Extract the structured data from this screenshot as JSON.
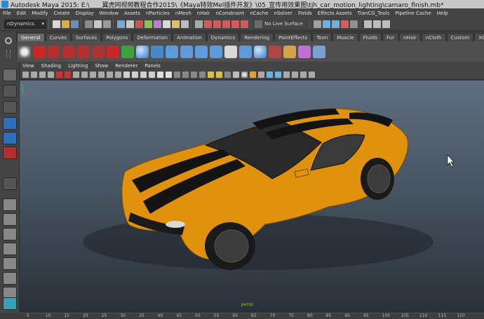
{
  "window": {
    "title": "Autodesk Maya 2015: E:\\____翼虎网视频教程合作2015\\《Maya特效Mel插件开发》\\05_宣传用效果图\\tjh_car_motion_lighting\\camaro_finish.mb*"
  },
  "menubar": {
    "items": [
      "File",
      "Edit",
      "Modify",
      "Create",
      "Display",
      "Window",
      "Assets",
      "nParticles",
      "nMesh",
      "nHair",
      "nConstraint",
      "nCache",
      "nSolver",
      "Fields",
      "Effects Assets",
      "TianCG_Tools",
      "Pipeline Cache",
      "Help"
    ]
  },
  "statusline": {
    "mode_value": "nDynamics",
    "live_surface_label": "No Live Surface"
  },
  "shelf": {
    "tabs": [
      "General",
      "Curves",
      "Surfaces",
      "Polygons",
      "Deformation",
      "Animation",
      "Dynamics",
      "Rendering",
      "PaintEffects",
      "Toon",
      "Muscle",
      "Fluids",
      "Fur",
      "nHair",
      "nCloth",
      "Custom",
      "XGen"
    ],
    "active_tab": "General"
  },
  "panel_menu": {
    "items": [
      "View",
      "Shading",
      "Lighting",
      "Show",
      "Renderer",
      "Panels"
    ]
  },
  "viewport": {
    "camera_label": "persp"
  },
  "timeslider": {
    "ticks": [
      "5",
      "10",
      "15",
      "20",
      "25",
      "30",
      "35",
      "40",
      "45",
      "50",
      "55",
      "60",
      "65",
      "70",
      "75",
      "80",
      "85",
      "90",
      "95",
      "100",
      "105",
      "110",
      "115",
      "120"
    ]
  },
  "colors": {
    "car_body": "#e0920e",
    "stripe": "#141414",
    "viewport_top": "#5f6f80",
    "viewport_bottom": "#2a3039"
  }
}
